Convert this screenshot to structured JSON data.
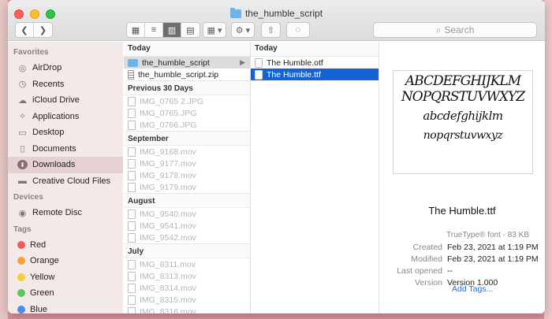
{
  "window": {
    "title": "the_humble_script"
  },
  "toolbar": {
    "back_label": "❮",
    "forward_label": "❯",
    "view_icons": [
      "▦",
      "≡",
      "▥",
      "▤"
    ],
    "group_label": "▦ ▾",
    "action_label": "⚙ ▾",
    "share_label": "⇧",
    "tag_label": "◌",
    "search_placeholder": "Search"
  },
  "sidebar": {
    "favorites_header": "Favorites",
    "favorites": [
      {
        "label": "AirDrop",
        "icon": "airdrop-icon"
      },
      {
        "label": "Recents",
        "icon": "clock-icon"
      },
      {
        "label": "iCloud Drive",
        "icon": "cloud-icon"
      },
      {
        "label": "Applications",
        "icon": "applications-icon"
      },
      {
        "label": "Desktop",
        "icon": "desktop-icon"
      },
      {
        "label": "Documents",
        "icon": "document-icon"
      },
      {
        "label": "Downloads",
        "icon": "download-icon",
        "selected": true
      },
      {
        "label": "Creative Cloud Files",
        "icon": "folder-icon"
      }
    ],
    "devices_header": "Devices",
    "devices": [
      {
        "label": "Remote Disc",
        "icon": "disc-icon"
      }
    ],
    "tags_header": "Tags",
    "tags": [
      {
        "label": "Red",
        "color": "#f55a5a"
      },
      {
        "label": "Orange",
        "color": "#f5a13c"
      },
      {
        "label": "Yellow",
        "color": "#f5cf3a"
      },
      {
        "label": "Green",
        "color": "#5cc85a"
      },
      {
        "label": "Blue",
        "color": "#4a8df5"
      }
    ]
  },
  "column1": {
    "today_header": "Today",
    "today": [
      {
        "name": "the_humble_script",
        "kind": "folder"
      },
      {
        "name": "the_humble_script.zip",
        "kind": "zip"
      }
    ],
    "previous30_header": "Previous 30 Days",
    "previous30": [
      "IMG_0765 2.JPG",
      "IMG_0765.JPG",
      "IMG_0766.JPG"
    ],
    "september_header": "September",
    "september": [
      "IMG_9168.mov",
      "IMG_9177.mov",
      "IMG_9178.mov",
      "IMG_9179.mov"
    ],
    "august_header": "August",
    "august": [
      "IMG_9540.mov",
      "IMG_9541.mov",
      "IMG_9542.mov"
    ],
    "july_header": "July",
    "july": [
      "IMG_8311.mov",
      "IMG_8313.mov",
      "IMG_8314.mov",
      "IMG_8315.mov",
      "IMG_8316.mov"
    ]
  },
  "column2": {
    "today_header": "Today",
    "files": [
      "The Humble.otf",
      "The Humble.ttf"
    ]
  },
  "preview": {
    "font_sample": {
      "line1": "ABCDEFGHIJKLM",
      "line2": "NOPQRSTUVWXYZ",
      "line3": "abcdefghijklm",
      "line4": "nopqrstuvwxyz"
    },
    "filename": "The Humble.ttf",
    "kind": "TrueType® font - 83 KB",
    "created_label": "Created",
    "created_value": "Feb 23, 2021 at 1:19 PM",
    "modified_label": "Modified",
    "modified_value": "Feb 23, 2021 at 1:19 PM",
    "last_opened_label": "Last opened",
    "last_opened_value": "--",
    "version_label": "Version",
    "version_value": "Version 1.000",
    "add_tags": "Add Tags..."
  }
}
